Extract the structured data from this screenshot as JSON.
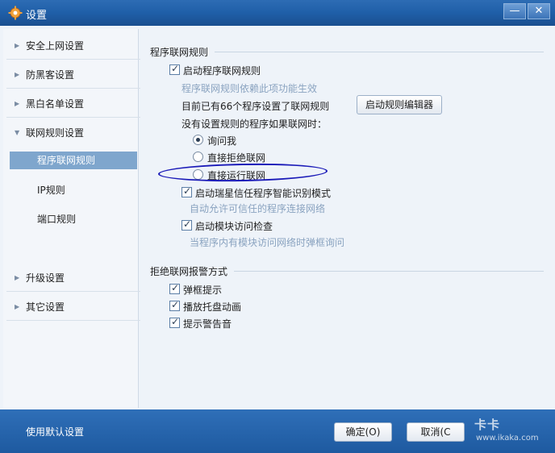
{
  "window": {
    "title": "设置",
    "minimize_label": "—",
    "close_label": "✕"
  },
  "sidebar": {
    "items": [
      {
        "label": "安全上网设置"
      },
      {
        "label": "防黑客设置"
      },
      {
        "label": "黑白名单设置"
      },
      {
        "label": "联网规则设置"
      },
      {
        "label": "升级设置"
      },
      {
        "label": "其它设置"
      }
    ],
    "subitems": [
      {
        "label": "程序联网规则",
        "selected": true
      },
      {
        "label": "IP规则",
        "selected": false
      },
      {
        "label": "端口规则",
        "selected": false
      }
    ]
  },
  "program_rules": {
    "section_title": "程序联网规则",
    "enable_label": "启动程序联网规则",
    "enable_checked": true,
    "enable_hint": "程序联网规则依赖此项功能生效",
    "count_text": "目前已有66个程序设置了联网规则",
    "editor_button": "启动规则编辑器",
    "no_rule_question": "没有设置规则的程序如果联网时：",
    "radio_options": [
      {
        "label": "询问我",
        "selected": true
      },
      {
        "label": "直接拒绝联网",
        "selected": false
      },
      {
        "label": "直接运行联网",
        "selected": false
      }
    ],
    "smart_label": "启动瑞星信任程序智能识别模式",
    "smart_checked": true,
    "smart_hint": "自动允许可信任的程序连接网络",
    "module_label": "启动模块访问检查",
    "module_checked": true,
    "module_hint": "当程序内有模块访问网络时弹框询问"
  },
  "alarm": {
    "section_title": "拒绝联网报警方式",
    "options": [
      {
        "label": "弹框提示",
        "checked": true
      },
      {
        "label": "播放托盘动画",
        "checked": true
      },
      {
        "label": "提示警告音",
        "checked": true
      }
    ]
  },
  "footer": {
    "default_label": "使用默认设置",
    "ok_label": "确定(O)",
    "cancel_label": "取消(C",
    "watermark_big": "卡卡",
    "watermark_small": "www.ikaka.com"
  },
  "icons": {
    "app": "gear-icon",
    "check": "check-icon",
    "chevron_right": "chevron-right-icon",
    "chevron_down": "chevron-down-icon"
  },
  "colors": {
    "titlebar": "#1f5fa8",
    "selected_nav": "#7fa6cd",
    "hint_text": "#8aa3c0",
    "annotation_oval": "#1a1ab8"
  }
}
